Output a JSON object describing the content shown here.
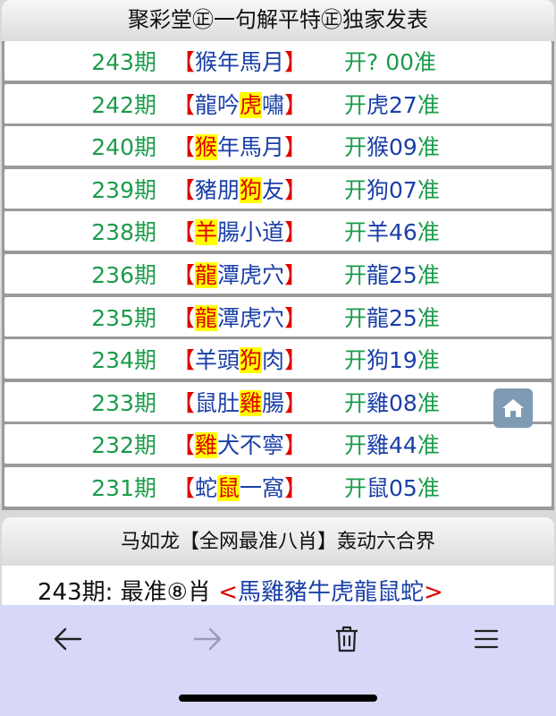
{
  "header1": "聚彩堂㊣一句解平特㊣独家发表",
  "rows": [
    {
      "issue": "243期",
      "p1": "",
      "hl": "",
      "p2": "猴年馬月",
      "result": "开?  00准",
      "zodiac": "",
      "num": ""
    },
    {
      "issue": "242期",
      "p1": "龍吟",
      "hl": "虎",
      "p2": "嘯",
      "result": "开",
      "zodiac": "虎",
      "num": "27",
      "tail": "准"
    },
    {
      "issue": "240期",
      "p1": "",
      "hl": "猴",
      "p2": "年馬月",
      "result": "开",
      "zodiac": "猴",
      "num": "09",
      "tail": "准"
    },
    {
      "issue": "239期",
      "p1": "豬朋",
      "hl": "狗",
      "p2": "友",
      "result": "开",
      "zodiac": "狗",
      "num": "07",
      "tail": "准"
    },
    {
      "issue": "238期",
      "p1": "",
      "hl": "羊",
      "p2": "腸小道",
      "result": "开",
      "zodiac": "羊",
      "num": "46",
      "tail": "准"
    },
    {
      "issue": "236期",
      "p1": "",
      "hl": "龍",
      "p2": "潭虎穴",
      "result": "开",
      "zodiac": "龍",
      "num": "25",
      "tail": "准"
    },
    {
      "issue": "235期",
      "p1": "",
      "hl": "龍",
      "p2": "潭虎穴",
      "result": "开",
      "zodiac": "龍",
      "num": "25",
      "tail": "准"
    },
    {
      "issue": "234期",
      "p1": "羊頭",
      "hl": "狗",
      "p2": "肉",
      "result": "开",
      "zodiac": "狗",
      "num": "19",
      "tail": "准"
    },
    {
      "issue": "233期",
      "p1": "鼠肚",
      "hl": "雞",
      "p2": "腸",
      "result": "开",
      "zodiac": "雞",
      "num": "08",
      "tail": "准"
    },
    {
      "issue": "232期",
      "p1": "",
      "hl": "雞",
      "p2": "犬不寧",
      "result": "开",
      "zodiac": "雞",
      "num": "44",
      "tail": "准"
    },
    {
      "issue": "231期",
      "p1": "蛇",
      "hl": "鼠",
      "p2": "一窩",
      "result": "开",
      "zodiac": "鼠",
      "num": "05",
      "tail": "准"
    }
  ],
  "header2": "马如龙【全网最准八肖】轰动六合界",
  "prediction": {
    "label": "243期: 最准⑧肖 ",
    "open": "<",
    "zodiacs": "馬雞豬牛虎龍鼠蛇",
    "close": ">"
  },
  "colors": {
    "issue": "#1a9c4a",
    "phrase": "#1a3fa8",
    "bracket": "#e00000",
    "highlight": "#ffff00",
    "toolbar": "#d7d7f7"
  }
}
